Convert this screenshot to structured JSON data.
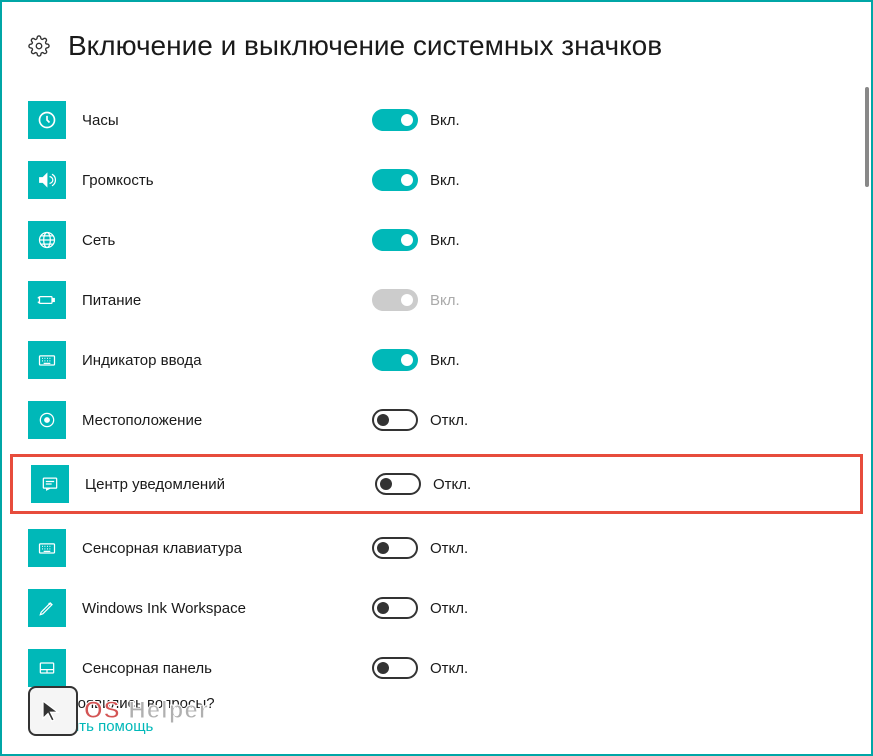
{
  "header": {
    "title": "Включение и выключение системных значков"
  },
  "states": {
    "on": "Вкл.",
    "off": "Откл."
  },
  "settings": [
    {
      "id": "clock",
      "label": "Часы",
      "state": "on",
      "disabled": false,
      "highlighted": false,
      "iconName": "clock-icon"
    },
    {
      "id": "volume",
      "label": "Громкость",
      "state": "on",
      "disabled": false,
      "highlighted": false,
      "iconName": "volume-icon"
    },
    {
      "id": "network",
      "label": "Сеть",
      "state": "on",
      "disabled": false,
      "highlighted": false,
      "iconName": "globe-icon"
    },
    {
      "id": "power",
      "label": "Питание",
      "state": "on",
      "disabled": true,
      "highlighted": false,
      "iconName": "battery-icon"
    },
    {
      "id": "ime",
      "label": "Индикатор ввода",
      "state": "on",
      "disabled": false,
      "highlighted": false,
      "iconName": "keyboard-icon"
    },
    {
      "id": "location",
      "label": "Местоположение",
      "state": "off",
      "disabled": false,
      "highlighted": false,
      "iconName": "target-icon"
    },
    {
      "id": "action-center",
      "label": "Центр уведомлений",
      "state": "off",
      "disabled": false,
      "highlighted": true,
      "iconName": "notification-icon"
    },
    {
      "id": "touch-keyboard",
      "label": "Сенсорная клавиатура",
      "state": "off",
      "disabled": false,
      "highlighted": false,
      "iconName": "keyboard-icon"
    },
    {
      "id": "ink",
      "label": "Windows Ink Workspace",
      "state": "off",
      "disabled": false,
      "highlighted": false,
      "iconName": "pen-icon"
    },
    {
      "id": "touchpad",
      "label": "Сенсорная панель",
      "state": "off",
      "disabled": false,
      "highlighted": false,
      "iconName": "touchpad-icon"
    }
  ],
  "footer": {
    "question": "У вас появились вопросы?",
    "help_link": "Получить помощь"
  },
  "colors": {
    "accent": "#00b8b8",
    "highlight": "#e74c3c"
  }
}
